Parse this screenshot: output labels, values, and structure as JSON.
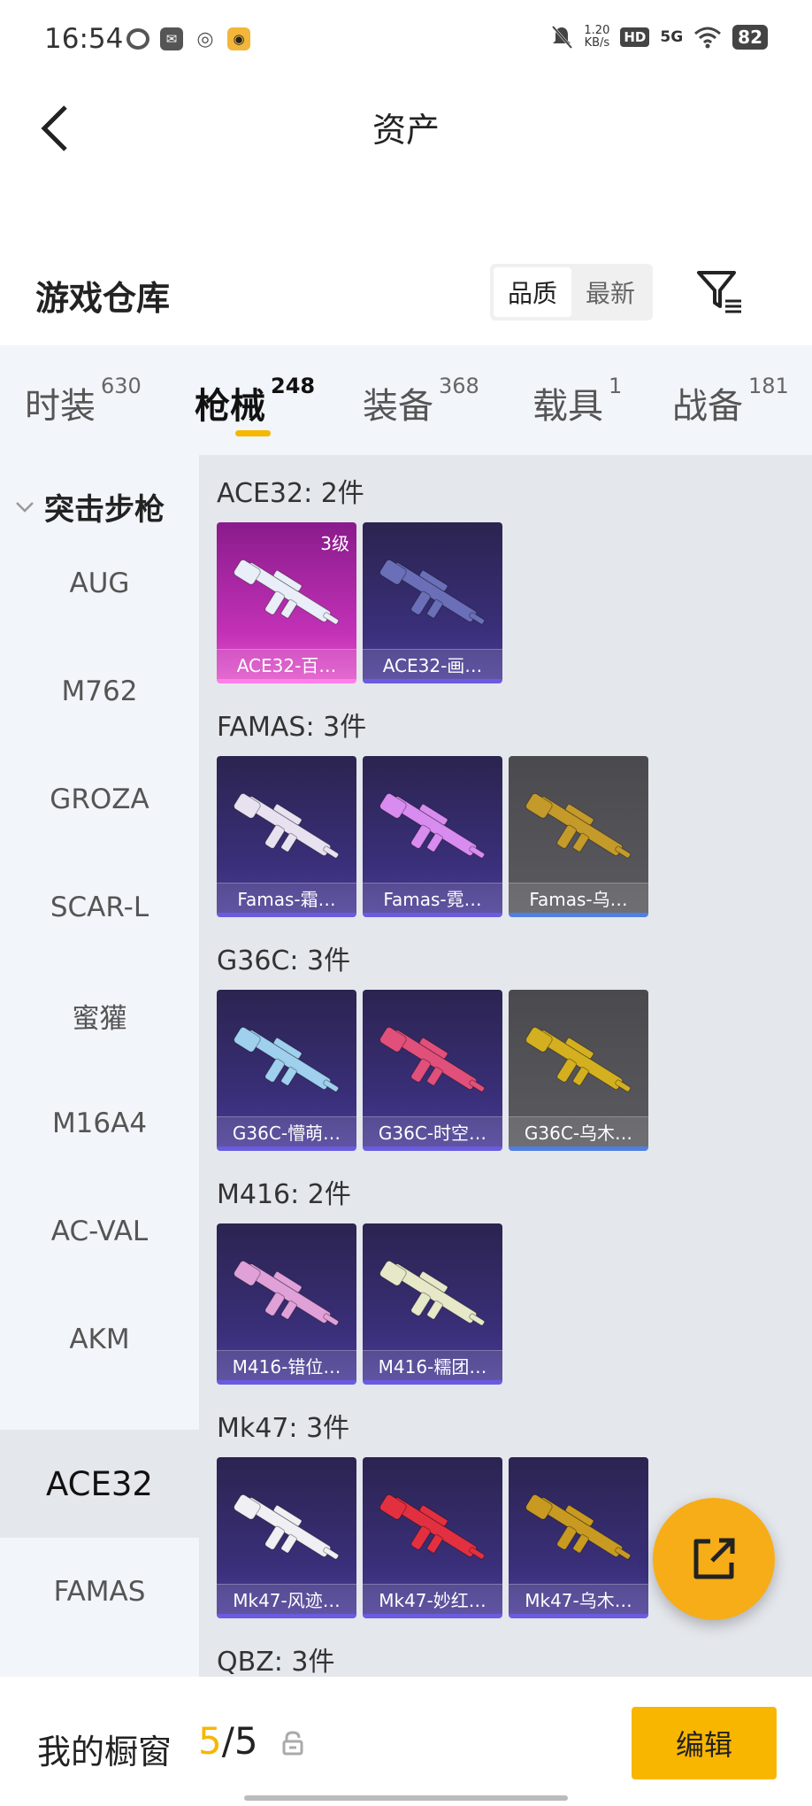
{
  "status_bar": {
    "time": "16:54",
    "net_speed_value": "1.20",
    "net_speed_unit": "KB/s",
    "hd": "HD",
    "network": "5G",
    "battery": "82"
  },
  "header": {
    "title": "资产"
  },
  "section": {
    "title": "游戏仓库",
    "sort_options": [
      "品质",
      "最新"
    ],
    "sort_active": "品质"
  },
  "category_tabs": [
    {
      "label": "时装",
      "count": "630",
      "active": false
    },
    {
      "label": "枪械",
      "count": "248",
      "active": true
    },
    {
      "label": "装备",
      "count": "368",
      "active": false
    },
    {
      "label": "载具",
      "count": "1",
      "active": false
    },
    {
      "label": "战备",
      "count": "181",
      "active": false
    }
  ],
  "sidebar": {
    "group": "突击步枪",
    "items": [
      "AUG",
      "M762",
      "GROZA",
      "SCAR-L",
      "蜜獾",
      "M16A4",
      "AC-VAL",
      "AKM",
      "ACE32",
      "FAMAS"
    ],
    "active_item": "ACE32"
  },
  "groups": [
    {
      "title": "ACE32: 2件",
      "items": [
        {
          "name": "ACE32-百…",
          "rarity": "pink",
          "level": "3级"
        },
        {
          "name": "ACE32-画…",
          "rarity": "purple",
          "level": ""
        }
      ]
    },
    {
      "title": "FAMAS: 3件",
      "items": [
        {
          "name": "Famas-霜…",
          "rarity": "purple",
          "level": ""
        },
        {
          "name": "Famas-霓…",
          "rarity": "purple",
          "level": ""
        },
        {
          "name": "Famas-乌…",
          "rarity": "gray",
          "level": ""
        }
      ]
    },
    {
      "title": "G36C: 3件",
      "items": [
        {
          "name": "G36C-懵萌…",
          "rarity": "purple",
          "level": ""
        },
        {
          "name": "G36C-时空…",
          "rarity": "purple",
          "level": ""
        },
        {
          "name": "G36C-乌木…",
          "rarity": "gray",
          "level": ""
        }
      ]
    },
    {
      "title": "M416: 2件",
      "items": [
        {
          "name": "M416-错位…",
          "rarity": "purple",
          "level": ""
        },
        {
          "name": "M416-糯团…",
          "rarity": "purple",
          "level": ""
        }
      ]
    },
    {
      "title": "Mk47: 3件",
      "items": [
        {
          "name": "Mk47-风迹…",
          "rarity": "purple",
          "level": ""
        },
        {
          "name": "Mk47-妙红…",
          "rarity": "purple",
          "level": ""
        },
        {
          "name": "Mk47-乌木…",
          "rarity": "purple",
          "level": ""
        }
      ]
    },
    {
      "title": "QBZ: 3件",
      "items": []
    }
  ],
  "gun_colors": [
    "#e9eef8",
    "#6a6fb8",
    "#e8e2f0",
    "#d98cf0",
    "#c49a2a",
    "#9fd0ee",
    "#e0507a",
    "#d4b020",
    "#e0a0d8",
    "#e6e8c8",
    "#f0f0f4",
    "#e23040",
    "#c89a22"
  ],
  "bottom_bar": {
    "label": "我的橱窗",
    "count_current": "5",
    "count_sep": "/",
    "count_total": "5",
    "edit_label": "编辑"
  },
  "icons": [
    "back-arrow-icon",
    "filter-icon",
    "chevron-down-icon",
    "share-icon",
    "lock-icon"
  ]
}
